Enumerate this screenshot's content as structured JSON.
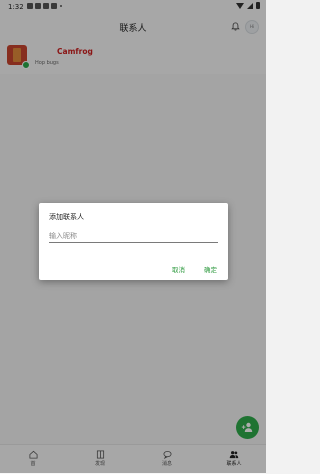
{
  "status_bar": {
    "time": "1:32"
  },
  "app_bar": {
    "title": "联系人",
    "avatar_text": "Hi"
  },
  "contact": {
    "name": "Camfrog",
    "subtitle": "Hop bugs"
  },
  "bottom_nav": {
    "items": [
      {
        "label": "首",
        "icon": "home-icon"
      },
      {
        "label": "发现",
        "icon": "door-icon"
      },
      {
        "label": "消息",
        "icon": "chat-icon"
      },
      {
        "label": "联系人",
        "icon": "people-icon",
        "active": true
      }
    ]
  },
  "dialog": {
    "title": "添加联系人",
    "input_placeholder": "输入昵称",
    "input_value": "",
    "cancel_label": "取消",
    "ok_label": "确定"
  },
  "colors": {
    "accent": "#2eaa4a",
    "contact_name": "#cc1f1f"
  }
}
